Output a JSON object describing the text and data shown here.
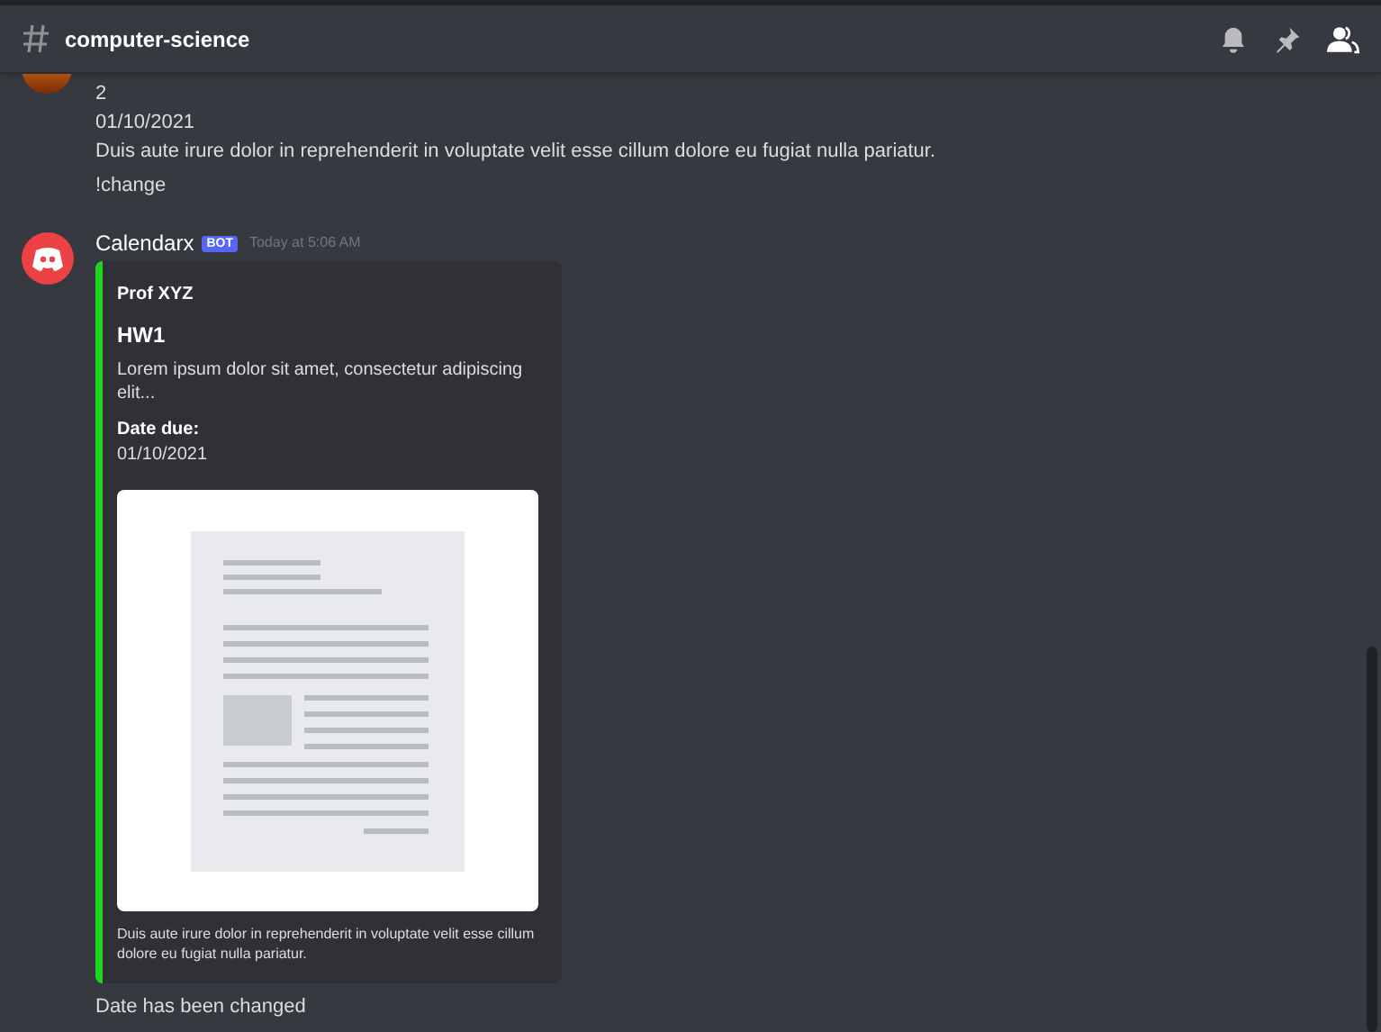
{
  "channel": {
    "name": "computer-science"
  },
  "messages": [
    {
      "kind": "continued",
      "lines": [
        "2",
        "01/10/2021",
        "Duis aute irure dolor in reprehenderit in voluptate velit esse cillum dolore eu fugiat nulla pariatur.",
        "!change"
      ]
    },
    {
      "kind": "bot",
      "author": "Calendarx",
      "badge": "BOT",
      "time": "Today at 5:06 AM",
      "embed": {
        "color": "#1fd51f",
        "author": "Prof XYZ",
        "title": "HW1",
        "description": "Lorem ipsum dolor sit amet, consectetur adipiscing elit...",
        "field_name": "Date due:",
        "field_value": "01/10/2021",
        "footer": "Duis aute irure dolor in reprehenderit in voluptate velit esse cillum dolore eu fugiat nulla pariatur."
      },
      "lines": [
        "Date has been changed"
      ]
    }
  ]
}
